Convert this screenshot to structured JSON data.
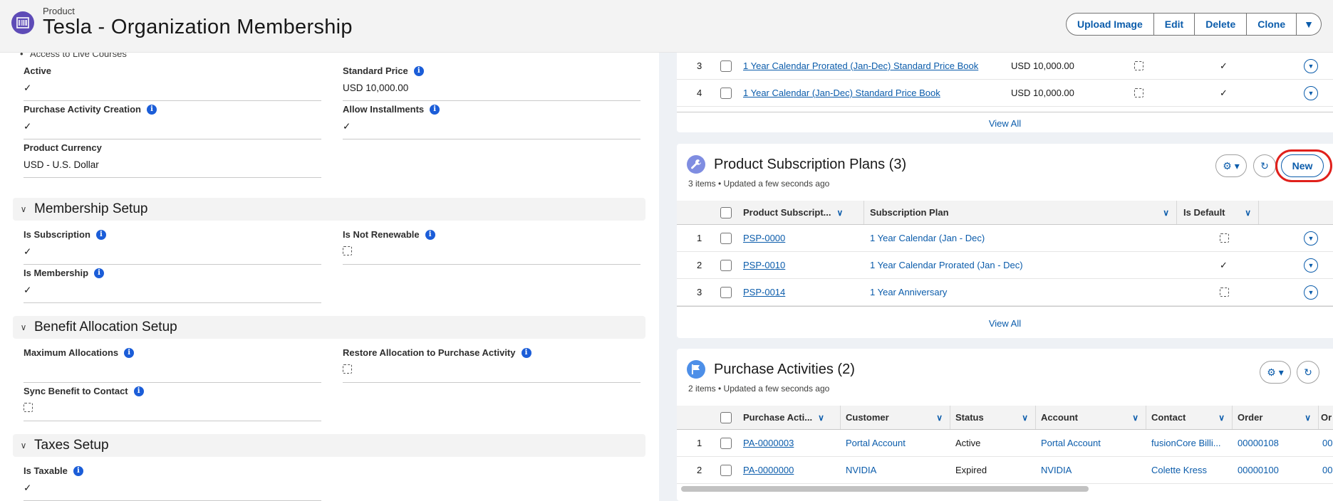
{
  "header": {
    "object_type": "Product",
    "title": "Tesla - Organization Membership",
    "actions": [
      "Upload Image",
      "Edit",
      "Delete",
      "Clone"
    ],
    "brand_color": "#5e4bb7"
  },
  "details": {
    "bullet_item": "Access to Live Courses",
    "fields": {
      "active": {
        "label": "Active",
        "checked": true
      },
      "standard_price": {
        "label": "Standard Price",
        "value": "USD 10,000.00"
      },
      "purchase_activity_creation": {
        "label": "Purchase Activity Creation",
        "checked": true
      },
      "allow_installments": {
        "label": "Allow Installments",
        "checked": true
      },
      "product_currency": {
        "label": "Product Currency",
        "value": "USD - U.S. Dollar"
      }
    },
    "sections": {
      "membership": {
        "title": "Membership Setup",
        "is_subscription": {
          "label": "Is Subscription",
          "checked": true
        },
        "is_not_renewable": {
          "label": "Is Not Renewable",
          "checked": false
        },
        "is_membership": {
          "label": "Is Membership",
          "checked": true
        }
      },
      "benefit": {
        "title": "Benefit Allocation Setup",
        "maximum_allocations": {
          "label": "Maximum Allocations",
          "value": ""
        },
        "restore_allocation": {
          "label": "Restore Allocation to Purchase Activity",
          "checked": false
        },
        "sync_benefit": {
          "label": "Sync Benefit to Contact",
          "checked": false
        }
      },
      "taxes": {
        "title": "Taxes Setup",
        "is_taxable": {
          "label": "Is Taxable",
          "checked": true
        }
      }
    }
  },
  "price_books": {
    "rows": [
      {
        "num": "3",
        "name": "1 Year Calendar Prorated (Jan-Dec) Standard Price Book",
        "price": "USD 10,000.00",
        "col4_checked": false,
        "col5_checked": true
      },
      {
        "num": "4",
        "name": "1 Year Calendar (Jan-Dec) Standard Price Book",
        "price": "USD 10,000.00",
        "col4_checked": false,
        "col5_checked": true
      }
    ],
    "view_all": "View All"
  },
  "subscription_plans": {
    "title": "Product Subscription Plans (3)",
    "subtitle": "3 items • Updated a few seconds ago",
    "new_label": "New",
    "columns": [
      "Product Subscript...",
      "Subscription Plan",
      "Is Default"
    ],
    "rows": [
      {
        "num": "1",
        "id": "PSP-0000",
        "plan": "1 Year Calendar (Jan - Dec)",
        "is_default": false
      },
      {
        "num": "2",
        "id": "PSP-0010",
        "plan": "1 Year Calendar Prorated (Jan - Dec)",
        "is_default": true
      },
      {
        "num": "3",
        "id": "PSP-0014",
        "plan": "1 Year Anniversary",
        "is_default": false
      }
    ],
    "view_all": "View All"
  },
  "purchase_activities": {
    "title": "Purchase Activities (2)",
    "subtitle": "2 items • Updated a few seconds ago",
    "columns": [
      "Purchase Acti...",
      "Customer",
      "Status",
      "Account",
      "Contact",
      "Order",
      "Or"
    ],
    "rows": [
      {
        "num": "1",
        "id": "PA-0000003",
        "customer": "Portal Account",
        "status": "Active",
        "account": "Portal Account",
        "contact": "fusionCore Billi...",
        "order": "00000108",
        "or": "00"
      },
      {
        "num": "2",
        "id": "PA-0000000",
        "customer": "NVIDIA",
        "status": "Expired",
        "account": "NVIDIA",
        "contact": "Colette Kress",
        "order": "00000100",
        "or": "00"
      }
    ]
  }
}
